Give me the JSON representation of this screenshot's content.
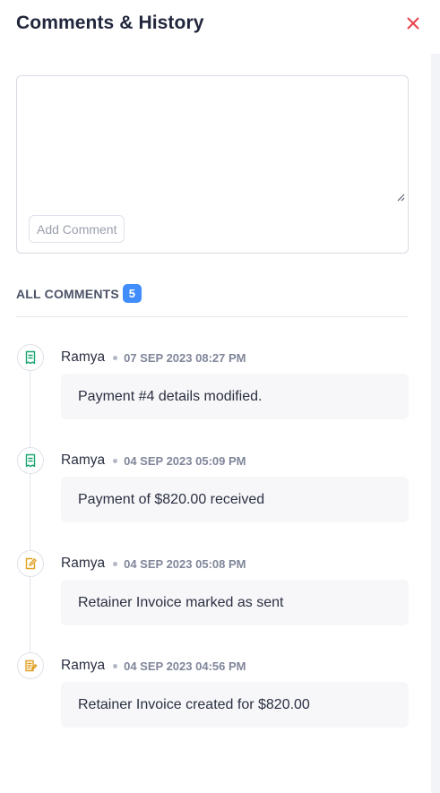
{
  "header": {
    "title": "Comments & History",
    "close_icon": "close-icon"
  },
  "comment_form": {
    "textarea_value": "",
    "add_button_label": "Add Comment"
  },
  "comments_section": {
    "title": "ALL COMMENTS",
    "count": "5"
  },
  "entries": [
    {
      "icon": "receipt-icon",
      "icon_color": "#1ba672",
      "author": "Ramya",
      "timestamp": "07 SEP 2023 08:27 PM",
      "text": "Payment #4 details modified."
    },
    {
      "icon": "receipt-icon",
      "icon_color": "#1ba672",
      "author": "Ramya",
      "timestamp": "04 SEP 2023 05:09 PM",
      "text": "Payment of $820.00 received"
    },
    {
      "icon": "edit-document-icon",
      "icon_color": "#e0a020",
      "author": "Ramya",
      "timestamp": "04 SEP 2023 05:08 PM",
      "text": "Retainer Invoice marked as sent"
    },
    {
      "icon": "document-lines-icon",
      "icon_color": "#e0a020",
      "author": "Ramya",
      "timestamp": "04 SEP 2023 04:56 PM",
      "text": "Retainer Invoice created for $820.00"
    }
  ],
  "colors": {
    "accent": "#408dfb",
    "close": "#e8424b",
    "bubble_bg": "#f7f7f9"
  }
}
